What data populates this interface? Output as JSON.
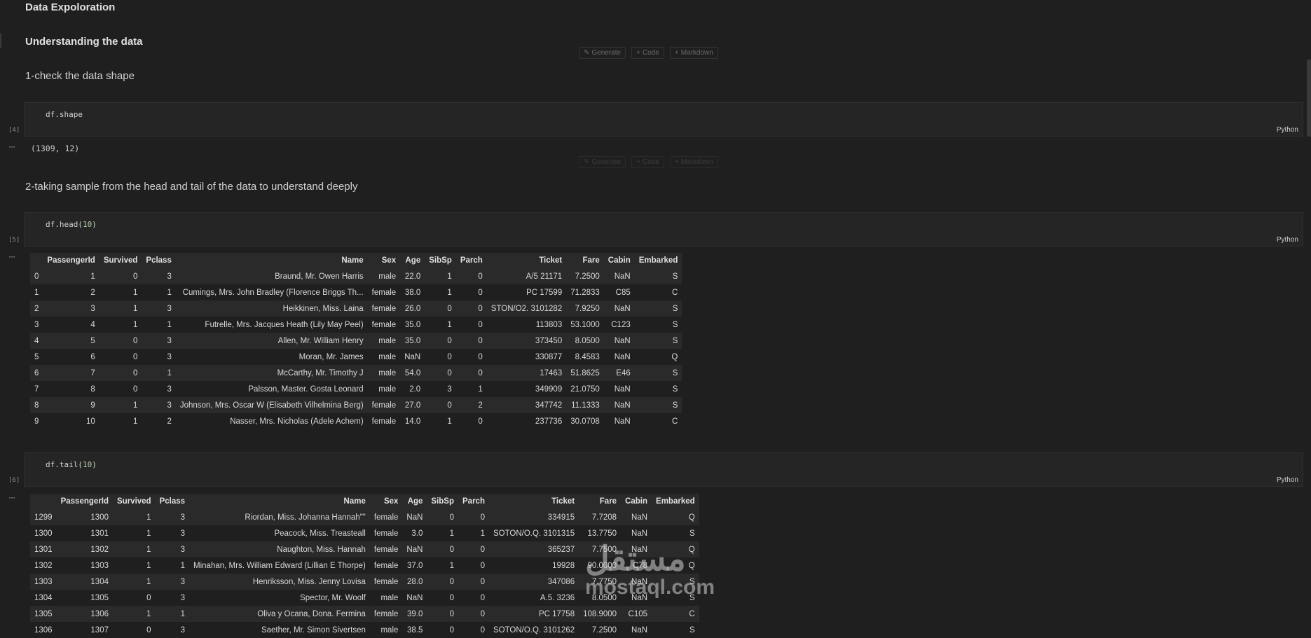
{
  "sections": {
    "title": "Data Expoloration",
    "subtitle": "Understanding the data",
    "step1": "1-check the data shape",
    "step2": "2-taking sample from the head and tail of the data to understand deeply"
  },
  "toolbar": {
    "generate": "Generate",
    "code": "Code",
    "markdown": "Markdown"
  },
  "cells": [
    {
      "exec": "[4]",
      "code": "df.shape",
      "lang": "Python",
      "output": "(1309, 12)"
    },
    {
      "exec": "[5]",
      "code_fn": "df.head(",
      "code_arg": "10",
      "code_end": ")",
      "lang": "Python"
    },
    {
      "exec": "[6]",
      "code_fn": "df.tail(",
      "code_arg": "10",
      "code_end": ")",
      "lang": "Python"
    }
  ],
  "output_marker": "···",
  "columns": [
    "",
    "PassengerId",
    "Survived",
    "Pclass",
    "Name",
    "Sex",
    "Age",
    "SibSp",
    "Parch",
    "Ticket",
    "Fare",
    "Cabin",
    "Embarked"
  ],
  "head_rows": [
    [
      "0",
      "1",
      "0",
      "3",
      "Braund, Mr. Owen Harris",
      "male",
      "22.0",
      "1",
      "0",
      "A/5 21171",
      "7.2500",
      "NaN",
      "S"
    ],
    [
      "1",
      "2",
      "1",
      "1",
      "Cumings, Mrs. John Bradley (Florence Briggs Th...",
      "female",
      "38.0",
      "1",
      "0",
      "PC 17599",
      "71.2833",
      "C85",
      "C"
    ],
    [
      "2",
      "3",
      "1",
      "3",
      "Heikkinen, Miss. Laina",
      "female",
      "26.0",
      "0",
      "0",
      "STON/O2. 3101282",
      "7.9250",
      "NaN",
      "S"
    ],
    [
      "3",
      "4",
      "1",
      "1",
      "Futrelle, Mrs. Jacques Heath (Lily May Peel)",
      "female",
      "35.0",
      "1",
      "0",
      "113803",
      "53.1000",
      "C123",
      "S"
    ],
    [
      "4",
      "5",
      "0",
      "3",
      "Allen, Mr. William Henry",
      "male",
      "35.0",
      "0",
      "0",
      "373450",
      "8.0500",
      "NaN",
      "S"
    ],
    [
      "5",
      "6",
      "0",
      "3",
      "Moran, Mr. James",
      "male",
      "NaN",
      "0",
      "0",
      "330877",
      "8.4583",
      "NaN",
      "Q"
    ],
    [
      "6",
      "7",
      "0",
      "1",
      "McCarthy, Mr. Timothy J",
      "male",
      "54.0",
      "0",
      "0",
      "17463",
      "51.8625",
      "E46",
      "S"
    ],
    [
      "7",
      "8",
      "0",
      "3",
      "Palsson, Master. Gosta Leonard",
      "male",
      "2.0",
      "3",
      "1",
      "349909",
      "21.0750",
      "NaN",
      "S"
    ],
    [
      "8",
      "9",
      "1",
      "3",
      "Johnson, Mrs. Oscar W (Elisabeth Vilhelmina Berg)",
      "female",
      "27.0",
      "0",
      "2",
      "347742",
      "11.1333",
      "NaN",
      "S"
    ],
    [
      "9",
      "10",
      "1",
      "2",
      "Nasser, Mrs. Nicholas (Adele Achem)",
      "female",
      "14.0",
      "1",
      "0",
      "237736",
      "30.0708",
      "NaN",
      "C"
    ]
  ],
  "tail_rows": [
    [
      "1299",
      "1300",
      "1",
      "3",
      "Riordan, Miss. Johanna Hannah\"\"",
      "female",
      "NaN",
      "0",
      "0",
      "334915",
      "7.7208",
      "NaN",
      "Q"
    ],
    [
      "1300",
      "1301",
      "1",
      "3",
      "Peacock, Miss. Treasteall",
      "female",
      "3.0",
      "1",
      "1",
      "SOTON/O.Q. 3101315",
      "13.7750",
      "NaN",
      "S"
    ],
    [
      "1301",
      "1302",
      "1",
      "3",
      "Naughton, Miss. Hannah",
      "female",
      "NaN",
      "0",
      "0",
      "365237",
      "7.7500",
      "NaN",
      "Q"
    ],
    [
      "1302",
      "1303",
      "1",
      "1",
      "Minahan, Mrs. William Edward (Lillian E Thorpe)",
      "female",
      "37.0",
      "1",
      "0",
      "19928",
      "90.0000",
      "C78",
      "Q"
    ],
    [
      "1303",
      "1304",
      "1",
      "3",
      "Henriksson, Miss. Jenny Lovisa",
      "female",
      "28.0",
      "0",
      "0",
      "347086",
      "7.7750",
      "NaN",
      "S"
    ],
    [
      "1304",
      "1305",
      "0",
      "3",
      "Spector, Mr. Woolf",
      "male",
      "NaN",
      "0",
      "0",
      "A.5. 3236",
      "8.0500",
      "NaN",
      "S"
    ],
    [
      "1305",
      "1306",
      "1",
      "1",
      "Oliva y Ocana, Dona. Fermina",
      "female",
      "39.0",
      "0",
      "0",
      "PC 17758",
      "108.9000",
      "C105",
      "C"
    ],
    [
      "1306",
      "1307",
      "0",
      "3",
      "Saether, Mr. Simon Sivertsen",
      "male",
      "38.5",
      "0",
      "0",
      "SOTON/O.Q. 3101262",
      "7.2500",
      "NaN",
      "S"
    ]
  ],
  "watermark": {
    "arabic": "مستقل",
    "latin": "mostaql.com"
  }
}
